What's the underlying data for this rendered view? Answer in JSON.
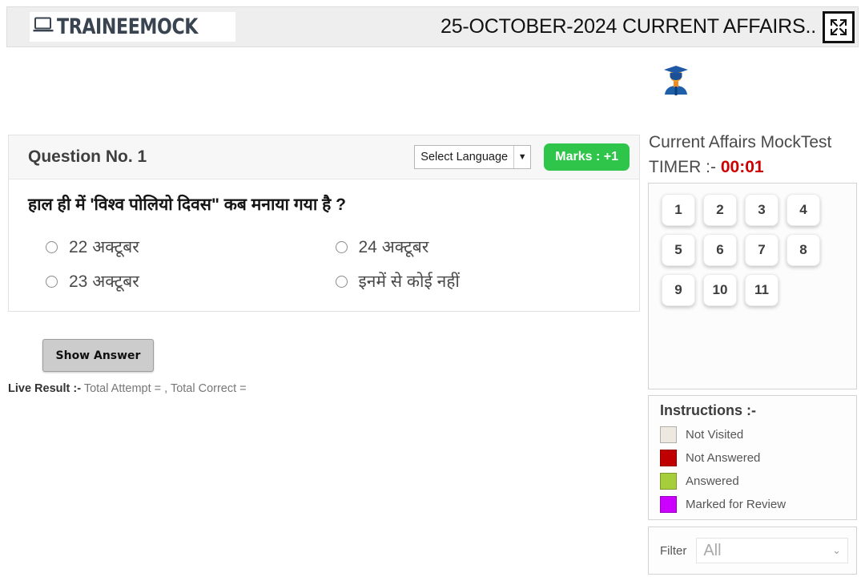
{
  "header": {
    "logo_text": "TRAINEEMOCK",
    "logo_icon": "laptop-icon",
    "title": "25-OCTOBER-2024 CURRENT AFFAIRS..",
    "fullscreen_icon": "fullscreen-expand-icon"
  },
  "brand_icon": "graduate-student-icon",
  "question": {
    "number_label": "Question No. 1",
    "language_select": {
      "value": "Select Language",
      "caret": "▼"
    },
    "marks_badge": "Marks : +1",
    "text": "हाल ही में 'विश्व पोलियो दिवस\" कब मनाया गया है ?",
    "options": [
      {
        "label": "22 अक्टूबर"
      },
      {
        "label": "24 अक्टूबर"
      },
      {
        "label": "23 अक्टूबर"
      },
      {
        "label": "इनमें से कोई नहीं"
      }
    ]
  },
  "actions": {
    "show_answer": "Show Answer"
  },
  "live_result": {
    "prefix": "Live Result :-",
    "text": " Total Attempt = , Total Correct ="
  },
  "sidebar": {
    "test_title": "Current Affairs MockTest",
    "timer_label": "TIMER :-",
    "timer_value": "00:01",
    "timer_color": "#cc0000",
    "question_numbers": [
      "1",
      "2",
      "3",
      "4",
      "5",
      "6",
      "7",
      "8",
      "9",
      "10",
      "11"
    ],
    "instructions": {
      "title": "Instructions :-",
      "legend": [
        {
          "label": "Not Visited",
          "color": "#ede9e0"
        },
        {
          "label": "Not Answered",
          "color": "#c00000"
        },
        {
          "label": "Answered",
          "color": "#a5ce3a"
        },
        {
          "label": "Marked for Review",
          "color": "#cc00ff"
        }
      ]
    },
    "filter": {
      "label": "Filter",
      "value": "All",
      "caret": "⌄"
    }
  },
  "colors": {
    "marks_green": "#2fc44a",
    "header_bg": "#eeeeee"
  }
}
